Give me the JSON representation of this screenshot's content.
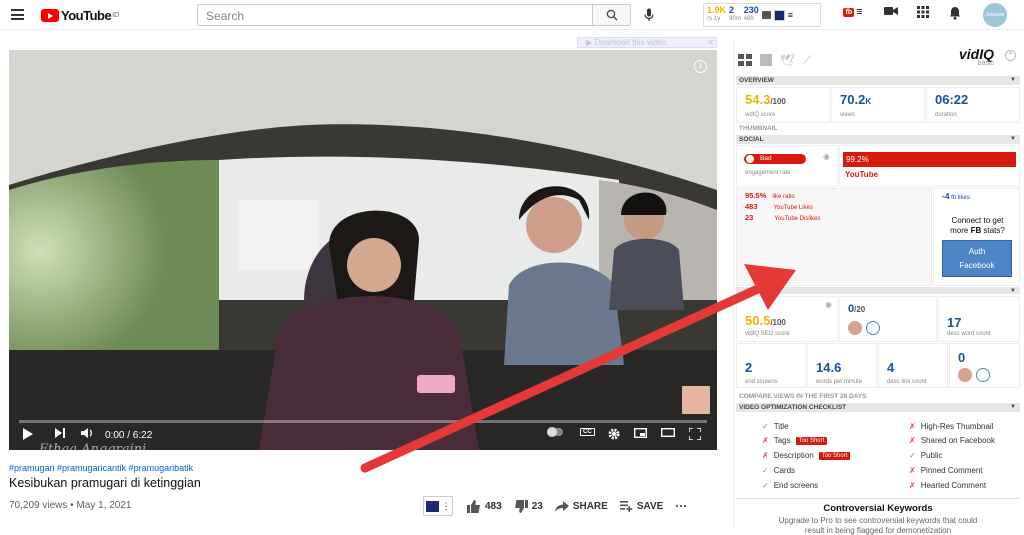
{
  "header": {
    "logo_text": "YouTube",
    "logo_sup": "ID",
    "search_placeholder": "Search",
    "vidiq_views": "1.9K",
    "vidiq_views_sub": "1y",
    "vidiq_comments": "2",
    "vidiq_comments_sub": "90m",
    "vidiq_subs": "230",
    "vidiq_subs_sub": "48h",
    "avatar_text": "Jebusan"
  },
  "player": {
    "download_bar": "Download this video",
    "overlay_title": "Fthaa Anggraini",
    "time": "0:00 / 6:22"
  },
  "video": {
    "hashtags": "#pramugari #pramugaricantik #pramugaribatik",
    "title": "Kesibukan pramugari di ketinggian",
    "meta": "70,209 views • May 1, 2021",
    "likes": "483",
    "dislikes": "23",
    "share_label": "SHARE",
    "save_label": "SAVE"
  },
  "vidiq": {
    "logo": "vidIQ",
    "plan": "basic",
    "overview_label": "OVERVIEW",
    "thumbnail_label": "THUMBNAIL",
    "social_label": "SOCIAL",
    "score": "54.3",
    "score_max": "/100",
    "score_label": "vidIQ score",
    "views": "70.2",
    "views_unit": "K",
    "views_label": "views",
    "duration": "06:22",
    "duration_label": "duration",
    "engagement_badge": "Bad",
    "engagement_label": "engagement rate",
    "yt_percent": "99.2%",
    "yt_label": "YouTube",
    "like_ratio": "95.5%",
    "like_ratio_label": "like ratio",
    "yt_likes": "483",
    "yt_likes_label": "YouTube Likes",
    "yt_dislikes": "23",
    "yt_dislikes_label": "YouTube Dislikes",
    "fb_likes": "4",
    "fb_likes_label": "fb likes",
    "fb_connect_1": "Connect to get",
    "fb_connect_2": "more ",
    "fb_connect_bold": "FB",
    "fb_connect_3": " stats?",
    "auth_label_1": "Auth",
    "auth_label_2": "Facebook",
    "seo_score": "50.5",
    "seo_max": "/100",
    "seo_label": "vidIQ SEO score",
    "tags_count": "0",
    "tags_max": "/20",
    "desc_words": "17",
    "desc_words_label": "desc word count",
    "end_screens": "2",
    "end_screens_label": "end screens",
    "wpm": "14.6",
    "wpm_label": "words per minute",
    "desc_links": "4",
    "desc_links_label": "desc link count",
    "right_zero": "0",
    "compare_label": "COMPARE VIEWS IN THE FIRST 28 DAYS",
    "checklist_label": "VIDEO OPTIMIZATION CHECKLIST",
    "too_short": "Too Short",
    "checklist_left": [
      "Title",
      "Tags",
      "Description",
      "Cards",
      "End screens"
    ],
    "checklist_right": [
      "High-Res Thumbnail",
      "Shared on Facebook",
      "Public",
      "Pinned Comment",
      "Hearted Comment"
    ],
    "controversial_title": "Controversial Keywords",
    "controversial_text": "Upgrade to Pro to see controversial keywords that could",
    "controversial_text2": "result in being flagged for demonetization"
  }
}
